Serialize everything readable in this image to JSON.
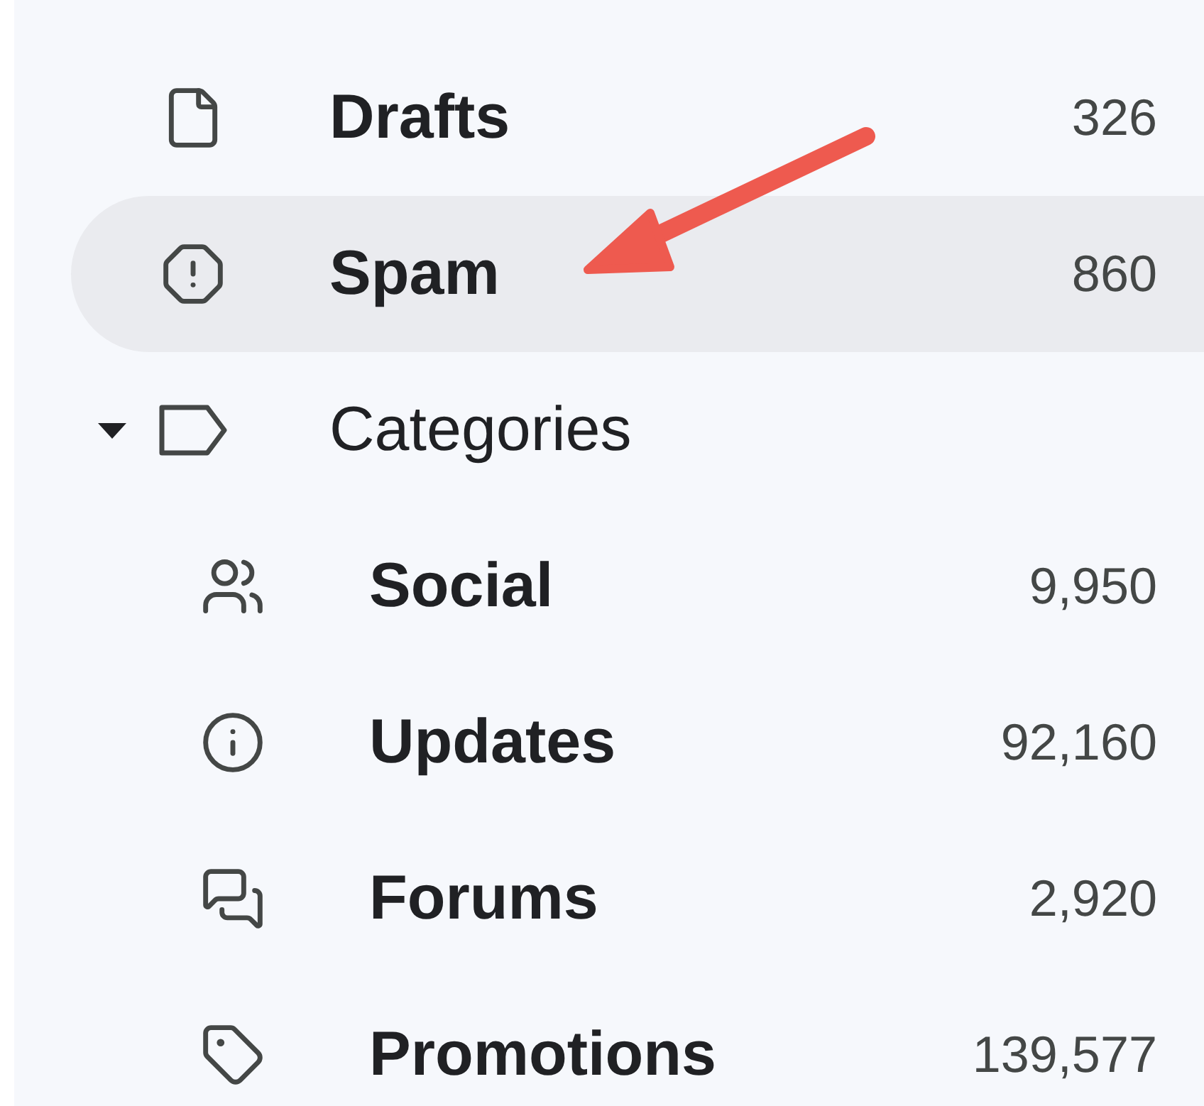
{
  "folders": [
    {
      "label": "Drafts",
      "count": "326",
      "selected": false
    },
    {
      "label": "Spam",
      "count": "860",
      "selected": true
    }
  ],
  "categories": {
    "label": "Categories",
    "expanded": true,
    "children": [
      {
        "label": "Social",
        "count": "9,950",
        "selected": false
      },
      {
        "label": "Updates",
        "count": "92,160",
        "selected": false
      },
      {
        "label": "Forums",
        "count": "2,920",
        "selected": false
      },
      {
        "label": "Promotions",
        "count": "139,577",
        "selected": false
      }
    ]
  }
}
